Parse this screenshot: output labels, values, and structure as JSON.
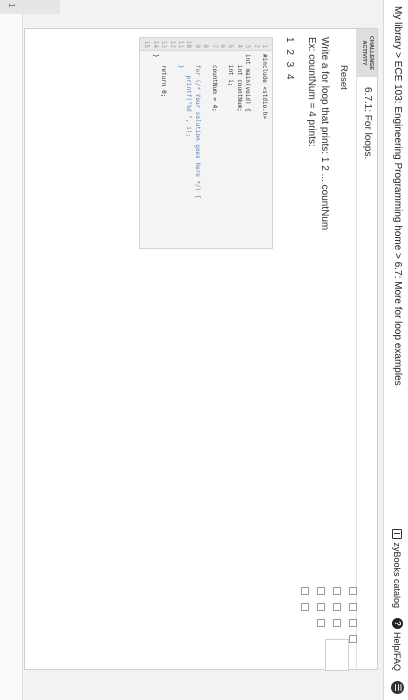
{
  "header": {
    "breadcrumb": "My library > ECE 103: Engineering Programming home > 6.7: More for loop examples",
    "catalog_label": "zyBooks catalog",
    "help_label": "Help/FAQ"
  },
  "activity": {
    "badge_line1": "CHALLENGE",
    "badge_line2": "ACTIVITY",
    "title": "6.7.1: For loops.",
    "reset_label": "Reset",
    "prompt_line1": "Write a for loop that prints: 1 2 ... countNum",
    "prompt_line2": "Ex: countNum = 4 prints:",
    "expected_output": "1 2 3 4"
  },
  "code_lines": [
    {
      "n": "1",
      "text": "#include <stdio.h>"
    },
    {
      "n": "2",
      "text": ""
    },
    {
      "n": "3",
      "text": "int main(void) {"
    },
    {
      "n": "4",
      "text": "   int countNum;"
    },
    {
      "n": "5",
      "text": "   int i;"
    },
    {
      "n": "6",
      "text": ""
    },
    {
      "n": "7",
      "text": "   countNum = 4;"
    },
    {
      "n": "8",
      "text": ""
    },
    {
      "n": "9",
      "text": "   for (/* Your solution goes here */) {"
    },
    {
      "n": "10",
      "text": "      printf(\"%d \", i);"
    },
    {
      "n": "11",
      "text": "   }"
    },
    {
      "n": "12",
      "text": ""
    },
    {
      "n": "13",
      "text": "   return 0;"
    },
    {
      "n": "14",
      "text": "}"
    },
    {
      "n": "15",
      "text": ""
    }
  ],
  "bottom": {
    "tab_number": "1"
  }
}
